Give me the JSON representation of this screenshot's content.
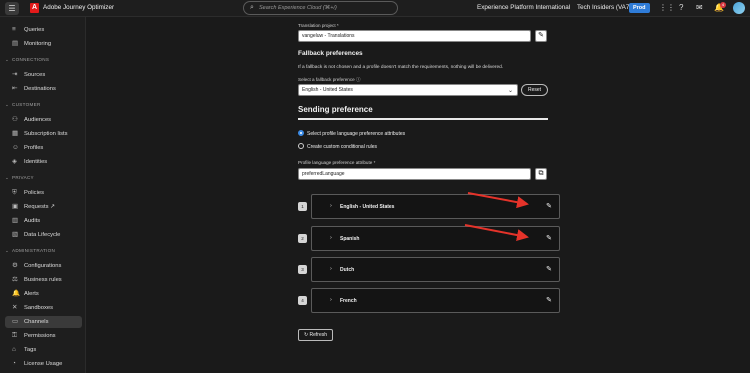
{
  "topbar": {
    "app_name": "Adobe Journey Optimizer",
    "search_placeholder": "Search Experience Cloud (⌘+/)",
    "org": "Experience Platform International",
    "sandbox": "Tech Insiders (VA7)",
    "env_badge": "Prod",
    "notification_count": "4"
  },
  "sidebar": {
    "items_top": [
      {
        "icon": "queries-icon",
        "glyph": "≡",
        "label": "Queries"
      },
      {
        "icon": "monitoring-icon",
        "glyph": "▤",
        "label": "Monitoring"
      }
    ],
    "connections": {
      "header": "CONNECTIONS",
      "items": [
        {
          "icon": "sources-icon",
          "glyph": "⇥",
          "label": "Sources"
        },
        {
          "icon": "destinations-icon",
          "glyph": "⇤",
          "label": "Destinations"
        }
      ]
    },
    "customer": {
      "header": "CUSTOMER",
      "items": [
        {
          "icon": "audiences-icon",
          "glyph": "⚇",
          "label": "Audiences"
        },
        {
          "icon": "subscription-lists-icon",
          "glyph": "▦",
          "label": "Subscription lists"
        },
        {
          "icon": "profiles-icon",
          "glyph": "☺",
          "label": "Profiles"
        },
        {
          "icon": "identities-icon",
          "glyph": "◈",
          "label": "Identities"
        }
      ]
    },
    "privacy": {
      "header": "PRIVACY",
      "items": [
        {
          "icon": "policies-icon",
          "glyph": "⛨",
          "label": "Policies"
        },
        {
          "icon": "requests-icon",
          "glyph": "▣",
          "label": "Requests ↗"
        },
        {
          "icon": "audits-icon",
          "glyph": "▥",
          "label": "Audits"
        },
        {
          "icon": "data-lifecycle-icon",
          "glyph": "▧",
          "label": "Data Lifecycle"
        }
      ]
    },
    "administration": {
      "header": "ADMINISTRATION",
      "items": [
        {
          "icon": "configurations-icon",
          "glyph": "⚙",
          "label": "Configurations"
        },
        {
          "icon": "business-rules-icon",
          "glyph": "⚖",
          "label": "Business rules"
        },
        {
          "icon": "alerts-icon",
          "glyph": "🔔",
          "label": "Alerts"
        },
        {
          "icon": "sandboxes-icon",
          "glyph": "✕",
          "label": "Sandboxes"
        },
        {
          "icon": "channels-icon",
          "glyph": "▭",
          "label": "Channels"
        },
        {
          "icon": "permissions-icon",
          "glyph": "⚿",
          "label": "Permissions"
        },
        {
          "icon": "tags-icon",
          "glyph": "⌂",
          "label": "Tags"
        },
        {
          "icon": "license-usage-icon",
          "glyph": "◔",
          "label": "License Usage"
        }
      ]
    }
  },
  "translation_project": {
    "label": "Translation project",
    "required_marker": "*",
    "value": "vangeluw - Translations"
  },
  "fallback": {
    "title": "Fallback preferences",
    "description": "If a fallback is not chosen and a profile doesn't match the requirements, nothing will be delivered.",
    "select_label": "Select a fallback preference",
    "selected": "English - United States",
    "reset_label": "Reset"
  },
  "sending": {
    "title": "Sending preference",
    "options": [
      {
        "label": "Select profile language preference attributes",
        "selected": true
      },
      {
        "label": "Create custom conditional rules",
        "selected": false
      }
    ],
    "attribute_label": "Profile language preference attribute",
    "required_marker": "*",
    "attribute_value": "preferredLanguage"
  },
  "languages": [
    {
      "num": "1",
      "name": "English - United States"
    },
    {
      "num": "2",
      "name": "Spanish"
    },
    {
      "num": "3",
      "name": "Dutch"
    },
    {
      "num": "4",
      "name": "French"
    }
  ],
  "refresh_label": "Refresh",
  "colors": {
    "accent": "#3b8be6",
    "arrow": "#e5332a",
    "badge": "#2f7cd8"
  }
}
